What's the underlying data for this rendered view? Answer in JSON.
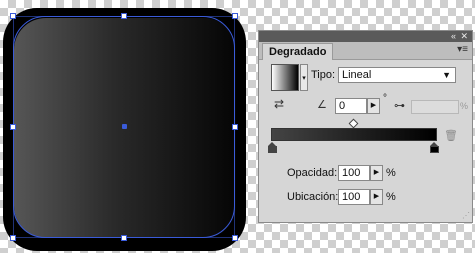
{
  "panel": {
    "title": "Degradado",
    "collapse_icon": "«",
    "close_icon": "✕",
    "menu_icon": "▾≡",
    "tipo_label": "Tipo:",
    "tipo_value": "Lineal",
    "angle_value": "0",
    "angle_unit": "°",
    "aspect_unit": "%",
    "opacity_label": "Opacidad:",
    "opacity_value": "100",
    "opacity_unit": "%",
    "location_label": "Ubicación:",
    "location_value": "100",
    "location_unit": "%"
  },
  "gradient": {
    "start_color": "#444444",
    "end_color": "#000000"
  },
  "icons": {
    "reverse": "reverse-gradient-icon",
    "angle": "angle-icon",
    "aspect": "aspect-ratio-icon",
    "trash": "trash-icon"
  }
}
